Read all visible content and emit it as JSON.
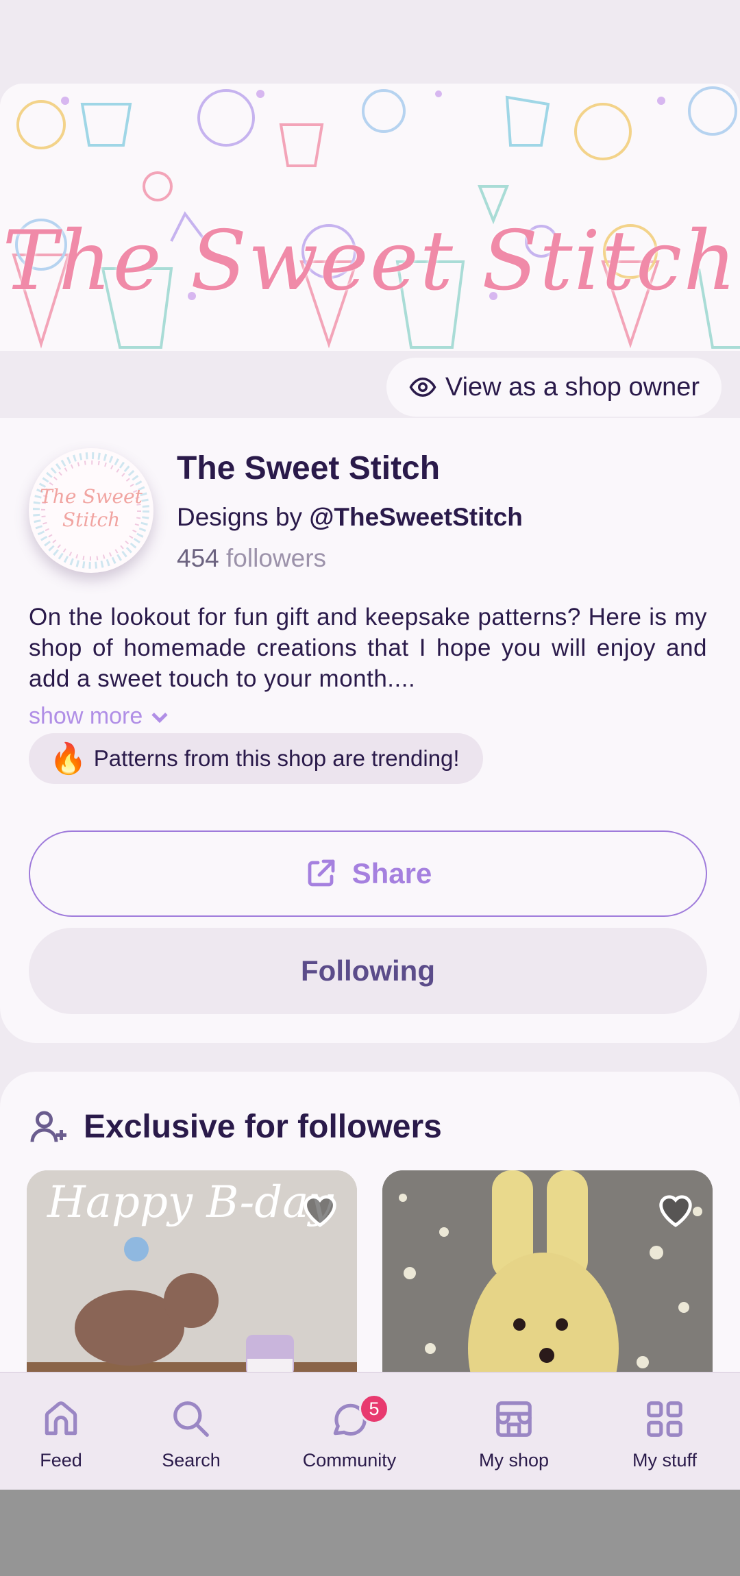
{
  "banner": {
    "title": "The Sweet Stitch"
  },
  "owner_button": {
    "label": "View as a shop owner",
    "icon": "eye-icon"
  },
  "shop": {
    "name": "The Sweet Stitch",
    "designs_prefix": "Designs by",
    "handle": "@TheSweetStitch",
    "followers_count": "454",
    "followers_label": "followers",
    "avatar_line1": "The Sweet",
    "avatar_line2": "Stitch",
    "description": "On the lookout for fun gift and keepsake patterns? Here is my shop of homemade creations that I hope you will enjoy and add a sweet touch to your month....",
    "show_more": "show more",
    "trending": {
      "emoji": "🔥",
      "text": "Patterns from this shop are trending!"
    }
  },
  "actions": {
    "share": "Share",
    "following": "Following"
  },
  "exclusive": {
    "title": "Exclusive for followers",
    "thumb1_caption": "Happy B-day"
  },
  "nav": {
    "items": [
      {
        "label": "Feed",
        "icon": "home-icon"
      },
      {
        "label": "Search",
        "icon": "search-icon"
      },
      {
        "label": "Community",
        "icon": "chat-icon",
        "badge": "5"
      },
      {
        "label": "My shop",
        "icon": "store-icon"
      },
      {
        "label": "My stuff",
        "icon": "grid-icon"
      }
    ]
  },
  "colors": {
    "accent": "#a580df",
    "text": "#2a1a4a",
    "badge": "#e8396f",
    "banner_text": "#f08aa8"
  }
}
